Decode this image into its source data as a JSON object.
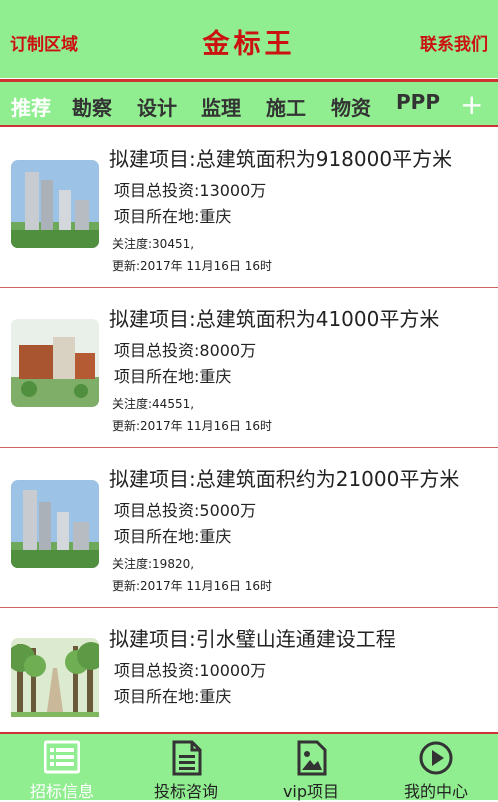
{
  "header": {
    "left": "订制区域",
    "title": "金标王",
    "right": "联系我们"
  },
  "tabs": [
    "推荐",
    "勘察",
    "设计",
    "监理",
    "施工",
    "物资",
    "PPP"
  ],
  "tab_add": "+",
  "items": [
    {
      "title": "拟建项目:总建筑面积为918000平方米",
      "investment": "项目总投资:13000万",
      "location": "项目所在地:重庆",
      "attention": "关注度:30451,",
      "updated": "更新:2017年 11月16日 16时"
    },
    {
      "title": "拟建项目:总建筑面积为41000平方米",
      "investment": "项目总投资:8000万",
      "location": "项目所在地:重庆",
      "attention": "关注度:44551,",
      "updated": "更新:2017年 11月16日 16时"
    },
    {
      "title": "拟建项目:总建筑面积约为21000平方米",
      "investment": "项目总投资:5000万",
      "location": "项目所在地:重庆",
      "attention": "关注度:19820,",
      "updated": "更新:2017年 11月16日 16时"
    },
    {
      "title": "拟建项目:引水璧山连通建设工程",
      "investment": "项目总投资:10000万",
      "location": "项目所在地:重庆",
      "attention": "",
      "updated": ""
    }
  ],
  "footer": [
    "招标信息",
    "投标咨询",
    "vip项目",
    "我的中心"
  ],
  "colors": {
    "brand_green": "#90ee90",
    "brand_red": "#cc1111"
  }
}
